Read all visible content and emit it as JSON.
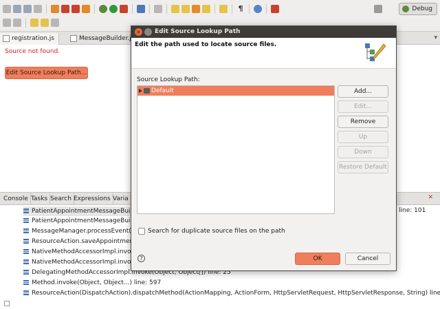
{
  "toolbar": {
    "perspective_label": "Debug"
  },
  "editor": {
    "tabs": [
      {
        "label": "registration.js"
      },
      {
        "label": "MessageBuilder.ja"
      }
    ],
    "message": "Source not found.",
    "edit_button_label": "Edit Source Lookup Path..."
  },
  "bottom_view": {
    "tabs": [
      {
        "label": "Console"
      },
      {
        "label": "Tasks"
      },
      {
        "label": "Search"
      },
      {
        "label": "Expressions"
      },
      {
        "label": "Varia"
      }
    ],
    "first_frame_line": "line: 101",
    "frames": [
      {
        "text": "PatientAppointmentMessageBui"
      },
      {
        "text": "PatientAppointmentMessageBui"
      },
      {
        "text": "MessageManager.processEvent(S"
      },
      {
        "text": "ResourceAction.saveAppointmen"
      },
      {
        "text": "NativeMethodAccessorImpl.invo"
      },
      {
        "text": "NativeMethodAccessorImpl.invo"
      },
      {
        "text": "DelegatingMethodAccessorImpl.invoke(Object, Object[]) line: 25"
      },
      {
        "text": "Method.invoke(Object, Object...) line: 597"
      },
      {
        "text": "ResourceAction(DispatchAction).dispatchMethod(ActionMapping, ActionForm, HttpServletRequest, HttpServletResponse, String) line: 265"
      }
    ]
  },
  "dialog": {
    "title": "Edit Source Lookup Path",
    "close_glyph": "×",
    "message": "Edit the path used to locate source files.",
    "list_label": "Source Lookup Path:",
    "entries": [
      {
        "label": "Default"
      }
    ],
    "buttons": {
      "add": "Add...",
      "edit": "Edit...",
      "remove": "Remove",
      "up": "Up",
      "down": "Down",
      "restore": "Restore Default"
    },
    "checkbox_label": "Search for duplicate source files on the path",
    "checkbox_checked": false,
    "help_glyph": "?",
    "ok_label": "OK",
    "cancel_label": "Cancel"
  },
  "colors": {
    "accent": "#ef7f5c",
    "titlebar": "#3d3c38",
    "error_text": "#c8232b"
  }
}
